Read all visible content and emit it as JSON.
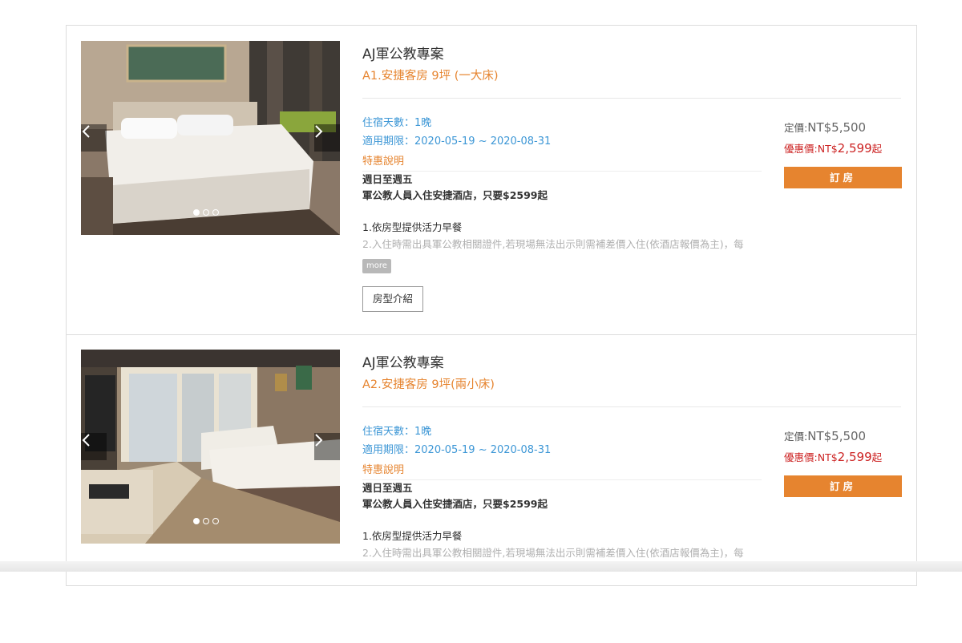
{
  "colors": {
    "accent": "#e6842f",
    "label_blue": "#3d97d6",
    "deal_red": "#cc2222"
  },
  "rooms": [
    {
      "plan_title": "AJ軍公教專案",
      "room_name": "A1.安捷客房 9坪 (一大床)",
      "stay_label": "住宿天數：",
      "stay_value": "1晚",
      "period_label": "適用期限：",
      "period_value": "2020-05-19 ~ 2020-08-31",
      "special_label": "特惠說明",
      "desc_bold_1": "週日至週五",
      "desc_bold_2": "軍公教人員入住安捷酒店，只要$2599起",
      "desc_plain": "1.依房型提供活力早餐",
      "desc_faded": "2.入住時需出具軍公教相關證件,若現場無法出示則需補差價入住(依酒店報價為主)，每",
      "more_label": "more",
      "intro_button": "房型介紹",
      "list_price_label": "定價:",
      "list_price_value": "NT$5,500",
      "deal_price_label": "優惠價:",
      "deal_price_prefix": "NT$",
      "deal_price_value": "2,599",
      "deal_price_suffix": "起",
      "book_button": "訂房",
      "photo_icon": "hotel-room-photo",
      "carousel_index": 1,
      "carousel_total": 3
    },
    {
      "plan_title": "AJ軍公教專案",
      "room_name": "A2.安捷客房 9坪(兩小床)",
      "stay_label": "住宿天數：",
      "stay_value": "1晚",
      "period_label": "適用期限：",
      "period_value": "2020-05-19 ~ 2020-08-31",
      "special_label": "特惠說明",
      "desc_bold_1": "週日至週五",
      "desc_bold_2": "軍公教人員入住安捷酒店，只要$2599起",
      "desc_plain": "1.依房型提供活力早餐",
      "desc_faded": "2.入住時需出具軍公教相關證件,若現場無法出示則需補差價入住(依酒店報價為主)，每",
      "list_price_label": "定價:",
      "list_price_value": "NT$5,500",
      "deal_price_label": "優惠價:",
      "deal_price_prefix": "NT$",
      "deal_price_value": "2,599",
      "deal_price_suffix": "起",
      "book_button": "訂房",
      "photo_icon": "hotel-room-photo",
      "carousel_index": 1,
      "carousel_total": 3
    }
  ]
}
